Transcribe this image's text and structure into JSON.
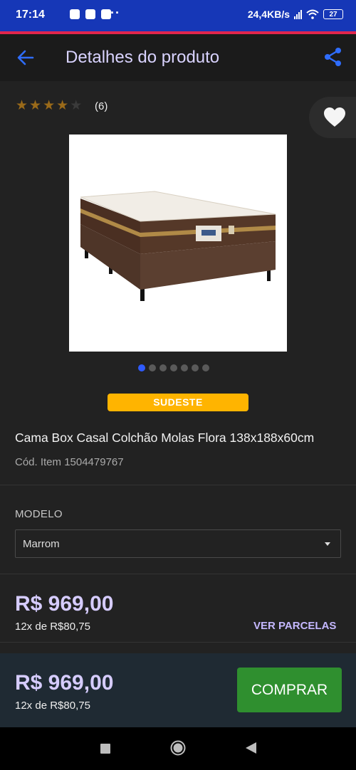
{
  "status_bar": {
    "time": "17:14",
    "net_speed": "24,4KB/s",
    "battery": "27",
    "more": "···"
  },
  "app_bar": {
    "title": "Detalhes do produto",
    "back_icon": "arrow-left-icon",
    "share_icon": "share-icon"
  },
  "rating": {
    "stars_filled": 4,
    "stars_total": 5,
    "count": "(6)"
  },
  "favorite_icon": "heart-icon",
  "gallery": {
    "image_count": 7,
    "active_index": 0
  },
  "region_badge": "SUDESTE",
  "product": {
    "name": "Cama Box Casal Colchão Molas Flora 138x188x60cm",
    "code": "Cód. Item 1504479767"
  },
  "model": {
    "label": "MODELO",
    "selected": "Marrom"
  },
  "pricing": {
    "price": "R$ 969,00",
    "installments": "12x de R$80,75",
    "ver_parcelas": "VER PARCELAS"
  },
  "bottom_bar": {
    "price": "R$ 969,00",
    "installments": "12x de R$80,75",
    "buy_label": "COMPRAR"
  },
  "colors": {
    "status_bar": "#1637b7",
    "accent_line": "#e2264d",
    "price": "#d6ccff",
    "buy_button": "#2f8f2f",
    "badge": "#ffb400",
    "star": "#9a6a19"
  }
}
